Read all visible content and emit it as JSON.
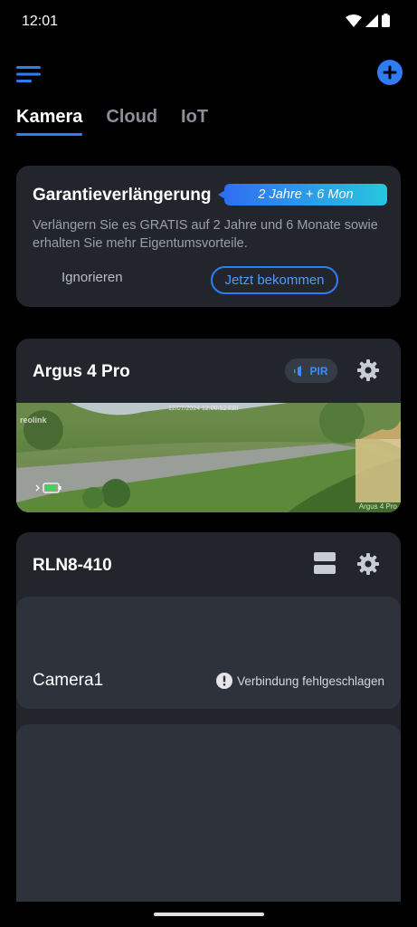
{
  "status": {
    "time": "12:01"
  },
  "tabs": [
    {
      "label": "Kamera",
      "active": true
    },
    {
      "label": "Cloud",
      "active": false
    },
    {
      "label": "IoT",
      "active": false
    }
  ],
  "promo": {
    "title": "Garantieverlängerung",
    "badge": "2 Jahre + 6 Mon",
    "text": "Verlängern Sie es GRATIS auf 2 Jahre und 6 Monate sowie erhalten Sie mehr Eigentumsvorteile.",
    "ignore_label": "Ignorieren",
    "get_label": "Jetzt bekommen"
  },
  "camera": {
    "name": "Argus 4 Pro",
    "pir_label": "PIR",
    "preview_timestamp": "12/07/2024 12:00:52 FRI",
    "preview_brand": "reolink",
    "preview_name": "Argus 4 Pro"
  },
  "nvr": {
    "name": "RLN8-410",
    "channels": [
      {
        "name": "Camera1",
        "status": "Verbindung fehlgeschlagen"
      }
    ]
  },
  "colors": {
    "accent": "#2f7cf6",
    "card_bg": "#22252c",
    "channel_bg": "#2e323b"
  }
}
